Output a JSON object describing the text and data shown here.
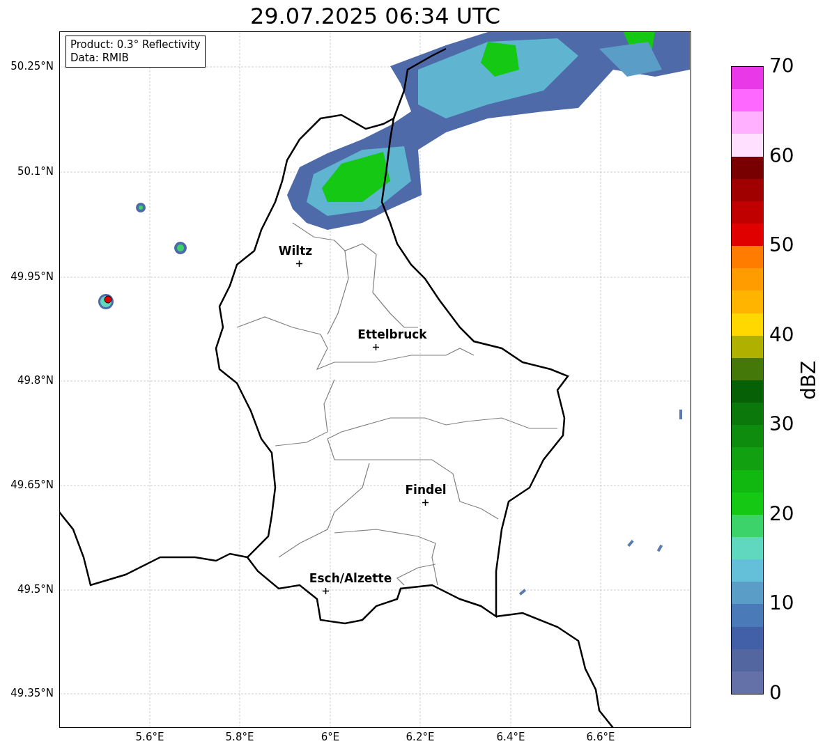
{
  "title": "29.07.2025 06:34 UTC",
  "legend": {
    "lines": [
      "Product: 0.3° Reflectivity",
      "Data: RMIB"
    ]
  },
  "map": {
    "lat_ticks": [
      "50.25°N",
      "50.1°N",
      "49.95°N",
      "49.8°N",
      "49.65°N",
      "49.5°N",
      "49.35°N"
    ],
    "lon_ticks": [
      "5.6°E",
      "5.8°E",
      "6°E",
      "6.2°E",
      "6.4°E",
      "6.6°E"
    ],
    "cities": [
      {
        "name": "Wiltz"
      },
      {
        "name": "Ettelbruck"
      },
      {
        "name": "Findel"
      },
      {
        "name": "Esch/Alzette"
      }
    ]
  },
  "colorbar": {
    "label": "dBZ",
    "ticks": [
      "70",
      "60",
      "50",
      "40",
      "30",
      "20",
      "10",
      "0"
    ],
    "bins": [
      {
        "color": "#6470a8"
      },
      {
        "color": "#5466a0"
      },
      {
        "color": "#4260a8"
      },
      {
        "color": "#4a7ab8"
      },
      {
        "color": "#5a9ec8"
      },
      {
        "color": "#64c0d8"
      },
      {
        "color": "#60d8c0"
      },
      {
        "color": "#3cd46a"
      },
      {
        "color": "#14c814"
      },
      {
        "color": "#10b810"
      },
      {
        "color": "#10a010"
      },
      {
        "color": "#0e8c0e"
      },
      {
        "color": "#0a780a"
      },
      {
        "color": "#066006"
      },
      {
        "color": "#447808"
      },
      {
        "color": "#b0b000"
      },
      {
        "color": "#ffd800"
      },
      {
        "color": "#ffb400"
      },
      {
        "color": "#ff9c00"
      },
      {
        "color": "#ff7c00"
      },
      {
        "color": "#e00000"
      },
      {
        "color": "#c00000"
      },
      {
        "color": "#a00000"
      },
      {
        "color": "#780000"
      },
      {
        "color": "#ffe0ff"
      },
      {
        "color": "#ffb0ff"
      },
      {
        "color": "#ff68ff"
      },
      {
        "color": "#e838e8"
      }
    ]
  }
}
